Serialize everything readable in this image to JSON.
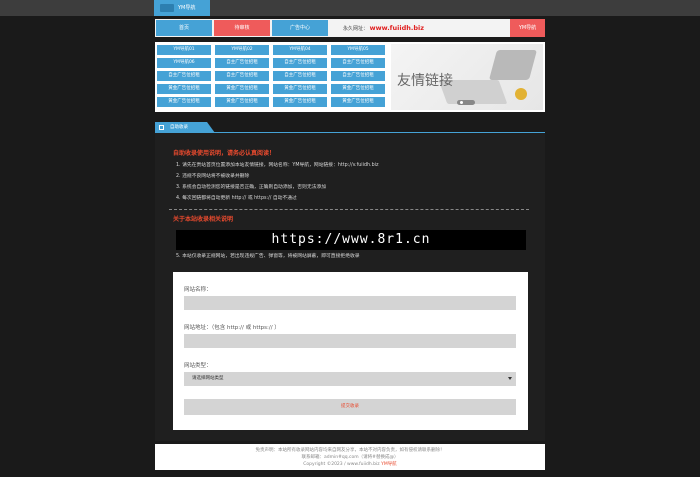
{
  "topbar": {
    "brand": "YM导航"
  },
  "nav": {
    "items": [
      "首页",
      "待审核",
      "广告中心"
    ],
    "domain_label": "永久网址：",
    "domain_url": "www.fuiidh.biz",
    "promo_button": "YM导航"
  },
  "links": [
    [
      "YM导航01",
      "YM导航02",
      "YM导航04",
      "YM导航05"
    ],
    [
      "YM导航06",
      "自主广告位招租",
      "自主广告位招租",
      "自主广告位招租"
    ],
    [
      "自主广告位招租",
      "自主广告位招租",
      "自主广告位招租",
      "自主广告位招租"
    ],
    [
      "黄金广告位招租",
      "黄金广告位招租",
      "黄金广告位招租",
      "黄金广告位招租"
    ],
    [
      "黄金广告位招租",
      "黄金广告位招租",
      "黄金广告位招租",
      "黄金广告位招租"
    ]
  ],
  "banner": {
    "text": "友情链接"
  },
  "notice": {
    "tab": "自助收录",
    "heading1": "自助收录使用说明，请务必认真阅读！",
    "rules": [
      "1. 请先在贵站首页位置添加本站友情链接，网站名称：YM导航，网站链接：http://v.fuiidh.biz",
      "2. 违规不良网站将不被收录并删除",
      "3. 系统会自动检测您的链接是否正确，正确则自动添加，否则无法添加",
      "4. 每次回链都将自动更新 http:// 或 https:// 自动不通过"
    ],
    "heading2": "关于本站收录相关说明",
    "watermark": "https://www.8r1.cn",
    "rule5": "5. 本站仅收录正规网站，若出现违规广告、弹窗等，将被网站屏蔽，即可直接拒绝收录"
  },
  "form": {
    "name_label": "网站名称：",
    "name_value": "",
    "url_label": "网站地址：（包含 http:// 或 https:// ）",
    "url_value": "",
    "type_label": "网站类型：",
    "type_value": "请选择网站类型",
    "submit": "提交收录"
  },
  "footer": {
    "line1": "免责声明：本站所有收录网站内容均来自网友分享，本站不对内容负责，如有侵权请联系删除！",
    "line2": "联系邮箱：admin#qq.com（请将#替换成@）",
    "line3_prefix": "Copyright ©2023 / www.fuiidh.biz",
    "line3_hl": "YM导航"
  },
  "colors": {
    "accent": "#45a2d6",
    "highlight": "#ef5b5b",
    "warning_text": "#e84a2e"
  }
}
